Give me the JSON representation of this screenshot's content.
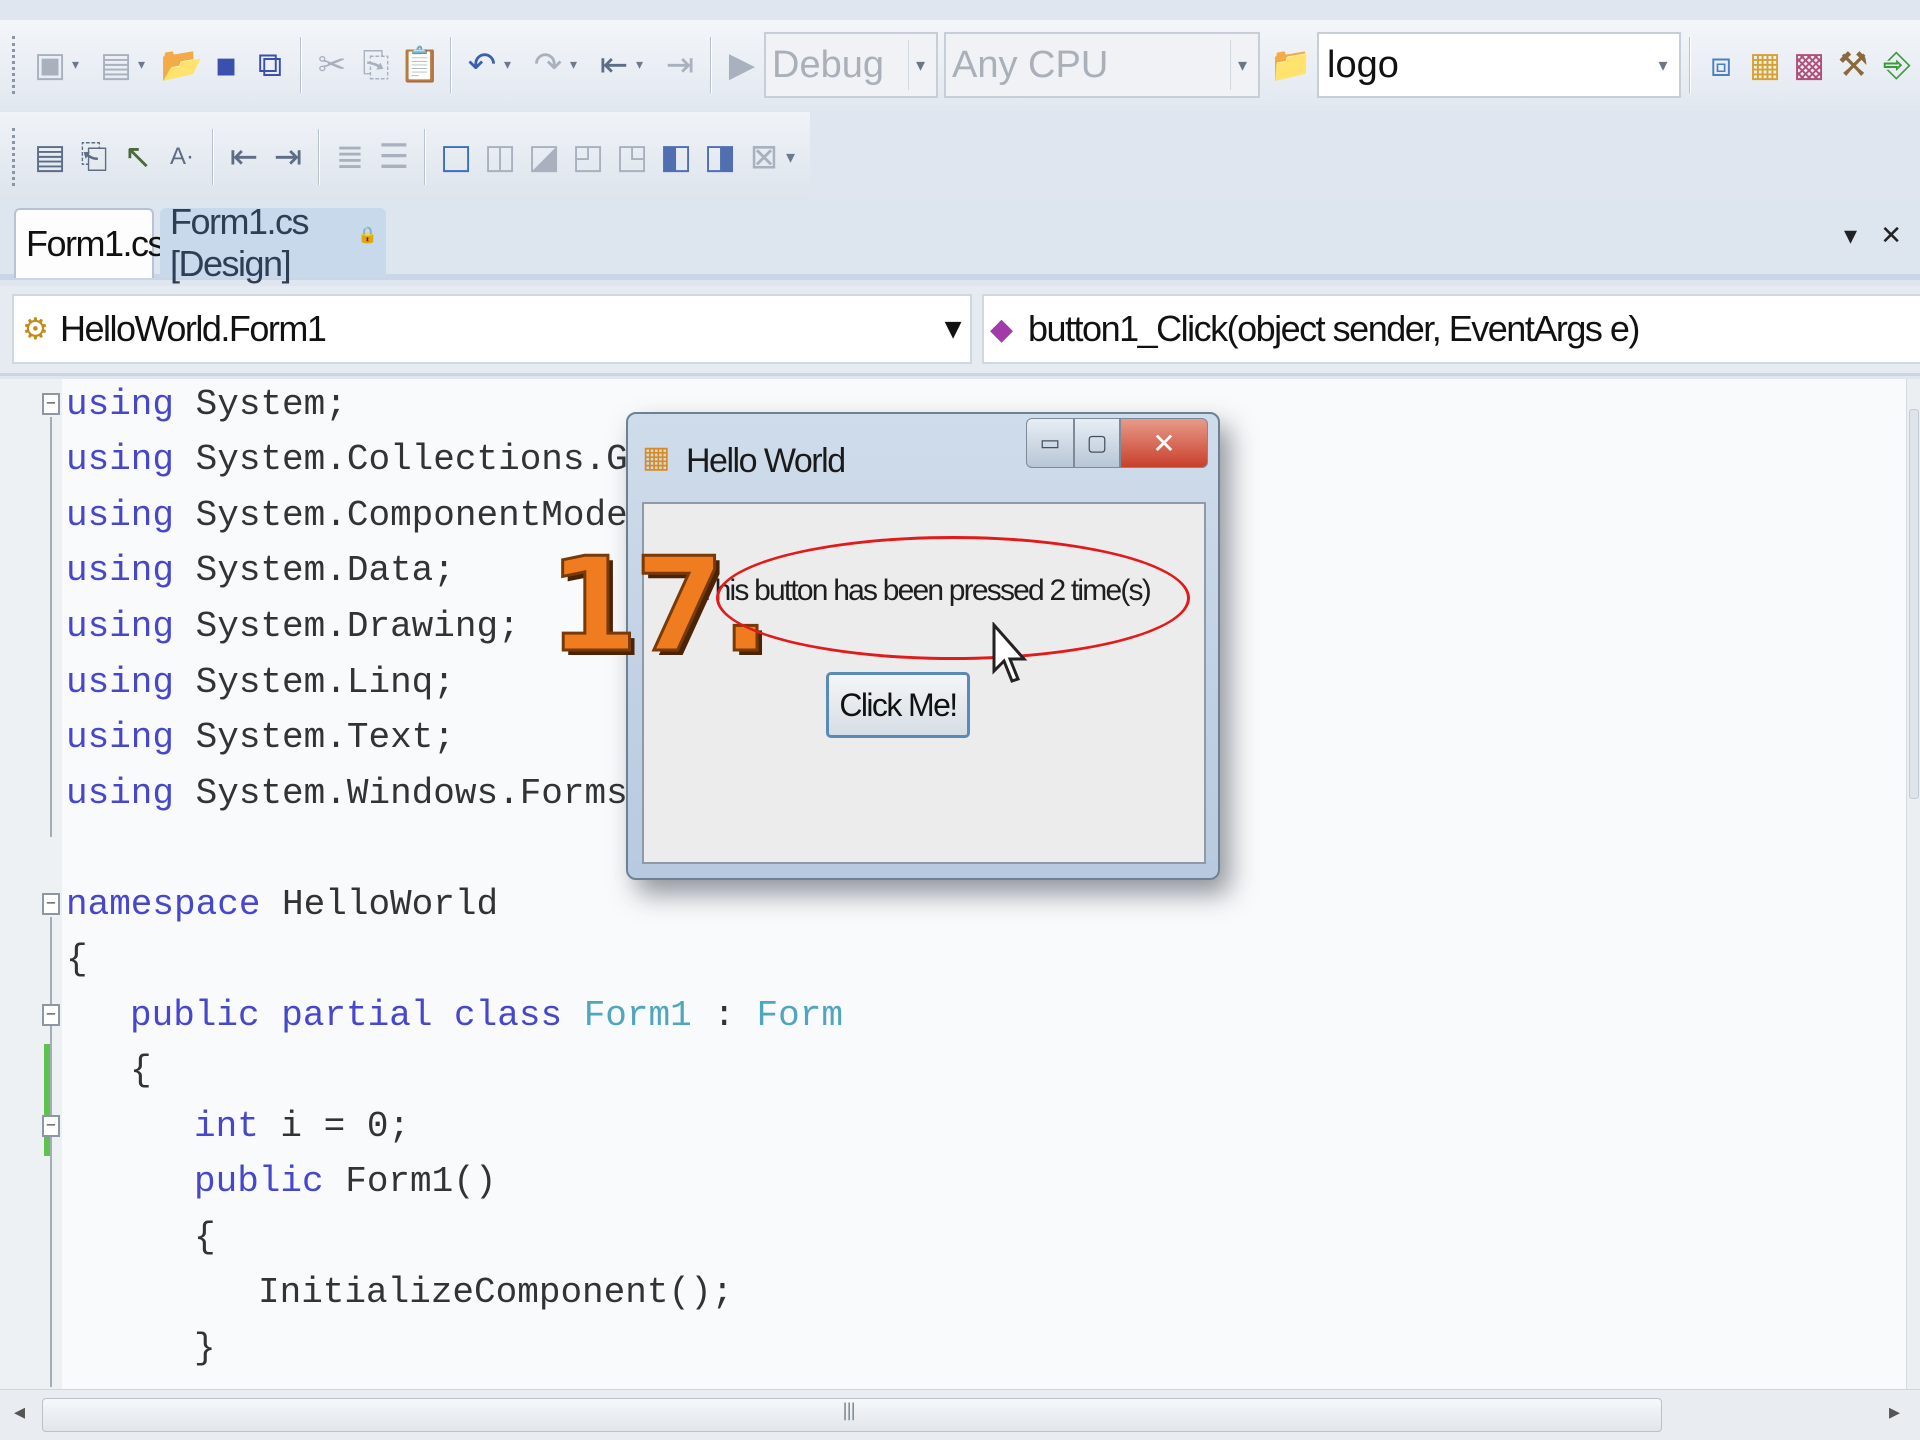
{
  "toolbar1": {
    "configuration": "Debug",
    "platform": "Any CPU",
    "startup_project": "logo"
  },
  "tabs": [
    {
      "label": "Form1.cs"
    },
    {
      "label": "Form1.cs [Design]"
    }
  ],
  "nav": {
    "type": "HelloWorld.Form1",
    "member": "button1_Click(object sender, EventArgs e)"
  },
  "code": {
    "l1": {
      "kw": "using",
      "rest": " System;"
    },
    "l2": {
      "kw": "using",
      "rest": " System.Collections.Generic;"
    },
    "l3": {
      "kw": "using",
      "rest": " System.ComponentModel;"
    },
    "l4": {
      "kw": "using",
      "rest": " System.Data;"
    },
    "l5": {
      "kw": "using",
      "rest": " System.Drawing;"
    },
    "l6": {
      "kw": "using",
      "rest": " System.Linq;"
    },
    "l7": {
      "kw": "using",
      "rest": " System.Text;"
    },
    "l8": {
      "kw": "using",
      "rest": " System.Windows.Forms;"
    },
    "l10": {
      "kw": "namespace",
      "rest": " HelloWorld"
    },
    "l11": {
      "text": "{"
    },
    "l12": {
      "kw": "public partial class",
      "type1": "Form1",
      "sep": " : ",
      "type2": "Form"
    },
    "l13": {
      "text": "{"
    },
    "l14": {
      "kw": "int",
      "rest": " i = 0;"
    },
    "l15": {
      "kw": "public",
      "rest": " Form1()"
    },
    "l16": {
      "text": "{"
    },
    "l17": {
      "text": "InitializeComponent();"
    },
    "l18": {
      "text": "}"
    }
  },
  "dialog": {
    "title": "Hello World",
    "message": "This button has been pressed 2 time(s)",
    "button_label": "Click Me!"
  },
  "annotation": {
    "step": "17."
  },
  "colors": {
    "keyword": "#4747cc",
    "type": "#4fa6bd",
    "step_number": "#ef7c1e",
    "highlight": "#e21a1a"
  }
}
